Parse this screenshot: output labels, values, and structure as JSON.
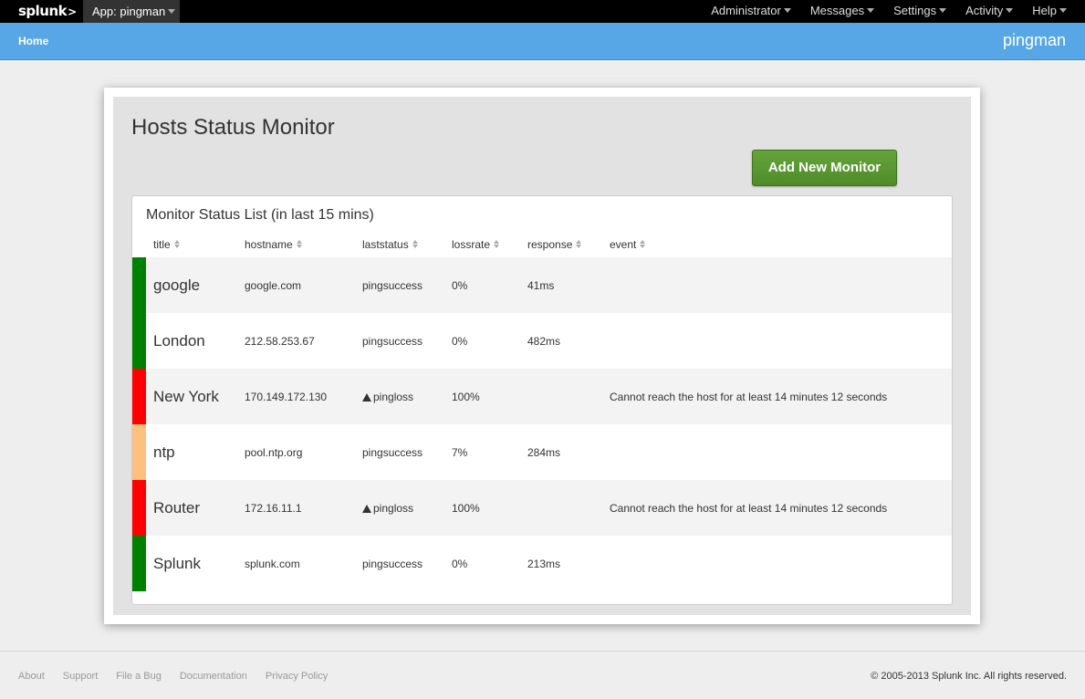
{
  "topbar": {
    "logo": "splunk",
    "logo_mark": ">",
    "app_menu": "App: pingman",
    "nav": [
      "Administrator",
      "Messages",
      "Settings",
      "Activity",
      "Help"
    ]
  },
  "appbar": {
    "home": "Home",
    "app_name": "pingman"
  },
  "page": {
    "title": "Hosts Status Monitor",
    "add_button": "Add New Monitor",
    "list_title": "Monitor Status List (in last 15 mins)"
  },
  "table": {
    "columns": [
      "title",
      "hostname",
      "laststatus",
      "lossrate",
      "response",
      "event"
    ],
    "rows": [
      {
        "status_color": "#008000",
        "title": "google",
        "hostname": "google.com",
        "laststatus": "pingsuccess",
        "warning": false,
        "lossrate": "0%",
        "response": "41ms",
        "event": ""
      },
      {
        "status_color": "#008000",
        "title": "London",
        "hostname": "212.58.253.67",
        "laststatus": "pingsuccess",
        "warning": false,
        "lossrate": "0%",
        "response": "482ms",
        "event": ""
      },
      {
        "status_color": "#ff0000",
        "title": "New York",
        "hostname": "170.149.172.130",
        "laststatus": "pingloss",
        "warning": true,
        "lossrate": "100%",
        "response": "",
        "event": "Cannot reach the host for at least 14 minutes 12 seconds"
      },
      {
        "status_color": "#fdc17f",
        "title": "ntp",
        "hostname": "pool.ntp.org",
        "laststatus": "pingsuccess",
        "warning": false,
        "lossrate": "7%",
        "response": "284ms",
        "event": ""
      },
      {
        "status_color": "#ff0000",
        "title": "Router",
        "hostname": "172.16.11.1",
        "laststatus": "pingloss",
        "warning": true,
        "lossrate": "100%",
        "response": "",
        "event": "Cannot reach the host for at least 14 minutes 12 seconds"
      },
      {
        "status_color": "#008000",
        "title": "Splunk",
        "hostname": "splunk.com",
        "laststatus": "pingsuccess",
        "warning": false,
        "lossrate": "0%",
        "response": "213ms",
        "event": ""
      }
    ]
  },
  "footer": {
    "links": [
      "About",
      "Support",
      "File a Bug",
      "Documentation",
      "Privacy Policy"
    ],
    "copyright": "© 2005-2013 Splunk Inc. All rights reserved."
  }
}
